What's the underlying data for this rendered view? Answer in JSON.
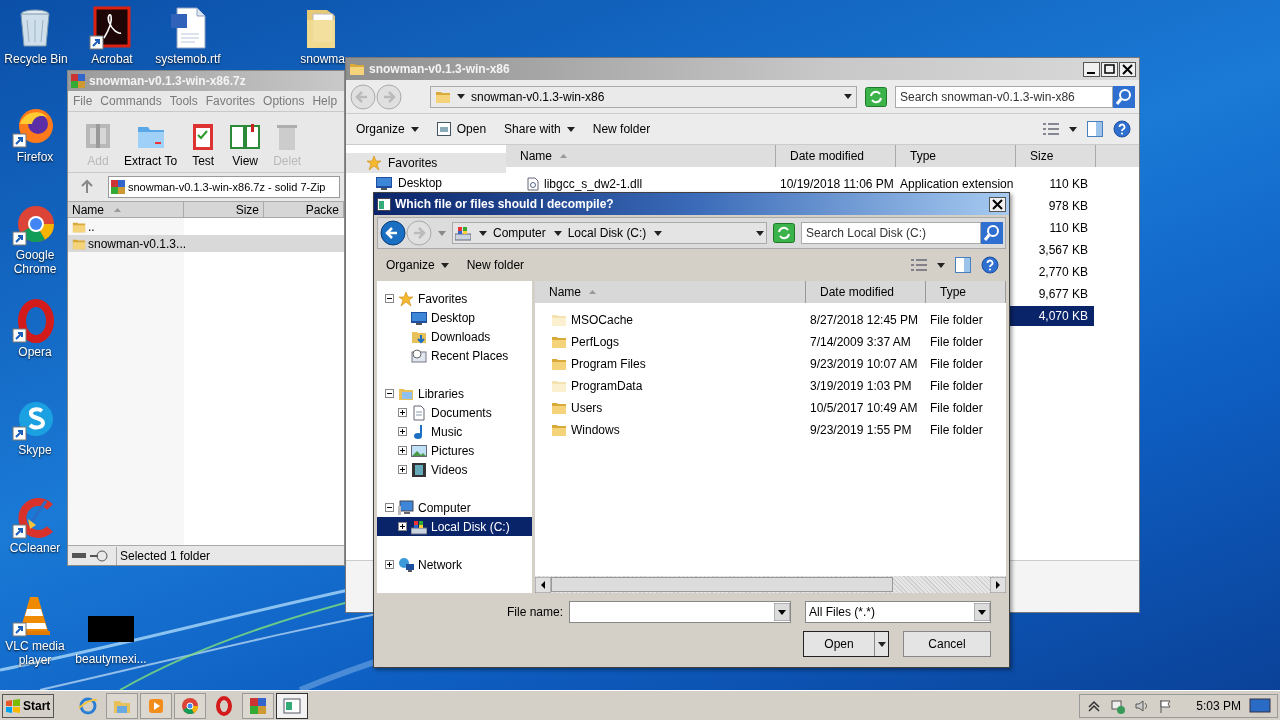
{
  "desktop_icons": [
    {
      "label": "Recycle Bin",
      "kind": "recycle",
      "shortcut": false
    },
    {
      "label": "Acrobat",
      "kind": "pdf",
      "shortcut": true
    },
    {
      "label": "systemob.rtf",
      "kind": "word",
      "shortcut": false
    },
    {
      "label": "snowma",
      "kind": "folder",
      "shortcut": false
    },
    {
      "label": "Firefox",
      "kind": "firefox",
      "shortcut": true
    },
    {
      "label": "Google Chrome",
      "kind": "chrome",
      "shortcut": true
    },
    {
      "label": "Opera",
      "kind": "opera",
      "shortcut": true
    },
    {
      "label": "Skype",
      "kind": "skype",
      "shortcut": true
    },
    {
      "label": "CCleaner",
      "kind": "ccleaner",
      "shortcut": true
    },
    {
      "label": "VLC media player",
      "kind": "vlc",
      "shortcut": true
    },
    {
      "label": "beautymexi...",
      "kind": "video",
      "shortcut": false
    }
  ],
  "sevenzip": {
    "title": "snowman-v0.1.3-win-x86.7z",
    "menu": [
      "File",
      "Commands",
      "Tools",
      "Favorites",
      "Options",
      "Help"
    ],
    "toolbar": [
      {
        "label": "Add",
        "kind": "add",
        "disabled": true
      },
      {
        "label": "Extract To",
        "kind": "extract",
        "disabled": false
      },
      {
        "label": "Test",
        "kind": "test",
        "disabled": false
      },
      {
        "label": "View",
        "kind": "view",
        "disabled": false
      },
      {
        "label": "Delet",
        "kind": "delete",
        "disabled": true
      }
    ],
    "path": "snowman-v0.1.3-win-x86.7z - solid 7-Zip",
    "columns": [
      "Name",
      "Size",
      "Packe"
    ],
    "rows": [
      {
        "name": "..",
        "selected": false
      },
      {
        "name": "snowman-v0.1.3...",
        "selected": true
      }
    ],
    "status": "Selected 1 folder"
  },
  "explorer": {
    "title": "snowman-v0.1.3-win-x86",
    "address": "snowman-v0.1.3-win-x86",
    "search_placeholder": "Search snowman-v0.1.3-win-x86",
    "nav_buttons": [
      {
        "kind": "back",
        "disabled": true
      },
      {
        "kind": "forward",
        "disabled": true
      }
    ],
    "toolbar": [
      {
        "label": "Organize",
        "kind": "menu"
      },
      {
        "label": "Open",
        "kind": "open"
      },
      {
        "label": "Share with",
        "kind": "menu"
      },
      {
        "label": "New folder",
        "kind": "plain"
      }
    ],
    "nav": [
      {
        "label": "Favorites",
        "kind": "star",
        "selected": true
      },
      {
        "label": "Desktop",
        "kind": "desktop",
        "selected": false
      }
    ],
    "columns": [
      "Name",
      "Date modified",
      "Type",
      "Size"
    ],
    "rows": [
      {
        "name": "libgcc_s_dw2-1.dll",
        "date": "10/19/2018 11:06 PM",
        "type": "Application extension",
        "size": "110 KB",
        "selected": false
      },
      {
        "size": "978 KB",
        "selected": false
      },
      {
        "size": "110 KB",
        "selected": false
      },
      {
        "size": "3,567 KB",
        "selected": false
      },
      {
        "size": "2,770 KB",
        "selected": false
      },
      {
        "size": "9,677 KB",
        "selected": false
      },
      {
        "size": "4,070 KB",
        "selected": true
      }
    ]
  },
  "dialog": {
    "title": "Which file or files should I decompile?",
    "nav_buttons": [
      {
        "kind": "back",
        "disabled": false
      },
      {
        "kind": "forward",
        "disabled": true
      }
    ],
    "breadcrumb": [
      "Computer",
      "Local Disk (C:)"
    ],
    "search_placeholder": "Search Local Disk (C:)",
    "toolbar": [
      {
        "label": "Organize",
        "kind": "menu"
      },
      {
        "label": "New folder",
        "kind": "plain"
      }
    ],
    "tree": [
      {
        "label": "Favorites",
        "kind": "star",
        "expanded": true,
        "selected": false,
        "children": [
          {
            "label": "Desktop",
            "kind": "desktop",
            "selected": false
          },
          {
            "label": "Downloads",
            "kind": "downloads",
            "selected": false
          },
          {
            "label": "Recent Places",
            "kind": "recent",
            "selected": false
          }
        ]
      },
      {
        "label": "Libraries",
        "kind": "libraries",
        "expanded": true,
        "selected": false,
        "children": [
          {
            "label": "Documents",
            "kind": "documents",
            "expanded": false,
            "selected": false
          },
          {
            "label": "Music",
            "kind": "music",
            "expanded": false,
            "selected": false
          },
          {
            "label": "Pictures",
            "kind": "pictures",
            "expanded": false,
            "selected": false
          },
          {
            "label": "Videos",
            "kind": "videos",
            "expanded": false,
            "selected": false
          }
        ]
      },
      {
        "label": "Computer",
        "kind": "computer",
        "expanded": true,
        "selected": false,
        "children": [
          {
            "label": "Local Disk (C:)",
            "kind": "disk",
            "expanded": false,
            "selected": true
          }
        ]
      },
      {
        "label": "Network",
        "kind": "network",
        "expanded": false,
        "selected": false
      }
    ],
    "columns": [
      "Name",
      "Date modified",
      "Type"
    ],
    "rows": [
      {
        "name": "MSOCache",
        "date": "8/27/2018 12:45 PM",
        "type": "File folder",
        "hidden": true
      },
      {
        "name": "PerfLogs",
        "date": "7/14/2009 3:37 AM",
        "type": "File folder",
        "hidden": false
      },
      {
        "name": "Program Files",
        "date": "9/23/2019 10:07 AM",
        "type": "File folder",
        "hidden": false
      },
      {
        "name": "ProgramData",
        "date": "3/19/2019 1:03 PM",
        "type": "File folder",
        "hidden": true
      },
      {
        "name": "Users",
        "date": "10/5/2017 10:49 AM",
        "type": "File folder",
        "hidden": false
      },
      {
        "name": "Windows",
        "date": "9/23/2019 1:55 PM",
        "type": "File folder",
        "hidden": false
      }
    ],
    "file_name_label": "File name:",
    "file_type": "All Files (*.*)",
    "buttons": [
      {
        "label": "Open",
        "kind": "split"
      },
      {
        "label": "Cancel",
        "kind": "plain"
      }
    ]
  },
  "taskbar": {
    "start": "Start",
    "apps": [
      {
        "kind": "ie",
        "running": false,
        "selected": false
      },
      {
        "kind": "explorer",
        "running": true,
        "selected": false
      },
      {
        "kind": "media",
        "running": true,
        "selected": false
      },
      {
        "kind": "chrome",
        "running": true,
        "selected": false
      },
      {
        "kind": "opera",
        "running": false,
        "selected": false
      },
      {
        "kind": "archive",
        "running": true,
        "selected": false
      },
      {
        "kind": "window",
        "running": true,
        "selected": true
      }
    ],
    "tray": [
      {
        "kind": "arrow"
      },
      {
        "kind": "network"
      },
      {
        "kind": "speaker"
      },
      {
        "kind": "flag"
      }
    ],
    "clock": "5:03 PM"
  }
}
